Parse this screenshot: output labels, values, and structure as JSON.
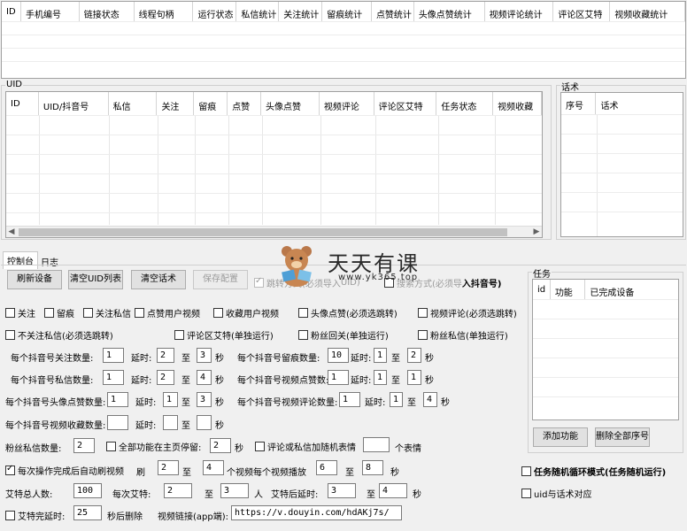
{
  "device_table": {
    "columns": [
      "ID",
      "手机编号",
      "链接状态",
      "线程句柄",
      "运行状态",
      "私信统计",
      "关注统计",
      "留痕统计",
      "点赞统计",
      "头像点赞统计",
      "视频评论统计",
      "评论区艾特",
      "视频收藏统计"
    ]
  },
  "uid_panel": {
    "title": "UID",
    "columns": [
      "ID",
      "UID/抖音号",
      "私信",
      "关注",
      "留痕",
      "点赞",
      "头像点赞",
      "视频评论",
      "评论区艾特",
      "任务状态",
      "视频收藏"
    ]
  },
  "script_panel": {
    "title": "话术",
    "columns": [
      "序号",
      "话术"
    ]
  },
  "tabs": [
    {
      "label": "控制台"
    },
    {
      "label": "日志"
    }
  ],
  "buttons": {
    "refresh": "刷新设备",
    "clear_uid": "清空UID列表",
    "clear_script": "清空话术",
    "save_config": "保存配置",
    "add_function": "添加功能",
    "delete_all_seq": "删除全部序号"
  },
  "mode_options": {
    "jump_import_prefix": "跳转方式(必须导入",
    "jump_import_uid": "UID)",
    "search_import_prefix": "搜索方式(必须导",
    "search_import_suffix": "入抖音号)"
  },
  "watermark": {
    "title": "天天有课",
    "url": "www.yk365.top"
  },
  "task_panel": {
    "title": "任务",
    "columns": [
      "id",
      "功能",
      "已完成设备"
    ]
  },
  "checkboxes_row1": [
    {
      "label": "关注",
      "checked": false
    },
    {
      "label": "留痕",
      "checked": false
    },
    {
      "label": "关注私信",
      "checked": false
    },
    {
      "label": "点赞用户视频",
      "checked": false
    },
    {
      "label": "收藏用户视频",
      "checked": false
    },
    {
      "label": "头像点赞(必须选跳转)",
      "checked": false
    },
    {
      "label": "视频评论(必须选跳转)",
      "checked": false
    }
  ],
  "checkboxes_row2": [
    {
      "label": "不关注私信(必须选跳转)",
      "checked": false
    },
    {
      "label": "评论区艾特(单独运行)",
      "checked": false
    },
    {
      "label": "粉丝回关(单独运行)",
      "checked": false
    },
    {
      "label": "粉丝私信(单独运行)",
      "checked": false
    }
  ],
  "settings": {
    "follow_count_label": "每个抖音号关注数量:",
    "follow_count": "1",
    "delay_label": "延时:",
    "to_label": "至",
    "sec_label": "秒",
    "follow_delay_min": "2",
    "follow_delay_max": "3",
    "trace_count_label": "每个抖音号留痕数量:",
    "trace_count": "10",
    "trace_delay_min": "1",
    "trace_delay_max": "2",
    "dm_count_label": "每个抖音号私信数量:",
    "dm_count": "1",
    "dm_delay_min": "2",
    "dm_delay_max": "4",
    "video_like_label": "每个抖音号视频点赞数:",
    "video_like_count": "1",
    "video_like_delay_min": "1",
    "video_like_delay_max": "1",
    "avatar_like_label": "每个抖音号头像点赞数量:",
    "avatar_like_count": "1",
    "avatar_like_delay_min": "1",
    "avatar_like_delay_max": "3",
    "video_comment_label": "每个抖音号视频评论数量:",
    "video_comment_count": "1",
    "video_comment_delay_min": "1",
    "video_comment_delay_max": "4",
    "video_fav_label": "每个抖音号视频收藏数量:",
    "video_fav_count": "",
    "video_fav_delay_min": "",
    "video_fav_delay_max": "",
    "fan_dm_label": "粉丝私信数量:",
    "fan_dm_count": "2",
    "homepage_stay_label": "全部功能在主页停留:",
    "homepage_stay": "2",
    "random_emoji_label": "评论或私信加随机表情",
    "random_emoji_count": "",
    "emoji_unit": "个表情",
    "auto_swipe_label": "每次操作完成后自动刷视频",
    "swipe_label": "刷",
    "swipe_min": "2",
    "swipe_max": "4",
    "per_video_play_label": "个视频每个视频播放",
    "play_min": "6",
    "play_max": "8",
    "random_loop_label": "任务随机循环模式(任务随机运行)",
    "at_total_label": "艾特总人数:",
    "at_total": "100",
    "at_each_label": "每次艾特:",
    "at_each_min": "2",
    "at_each_max": "3",
    "person_unit": "人",
    "after_at_delay_label": "艾特后延时:",
    "after_at_delay_min": "3",
    "after_at_delay_max": "4",
    "uid_script_match_label": "uid与话术对应",
    "at_done_delay_label": "艾特完延时:",
    "at_done_delay": "25",
    "delete_after_label": "秒后删除",
    "video_link_label": "视频链接(app端):",
    "video_link": "https://v.douyin.com/hdAKj7s/"
  }
}
